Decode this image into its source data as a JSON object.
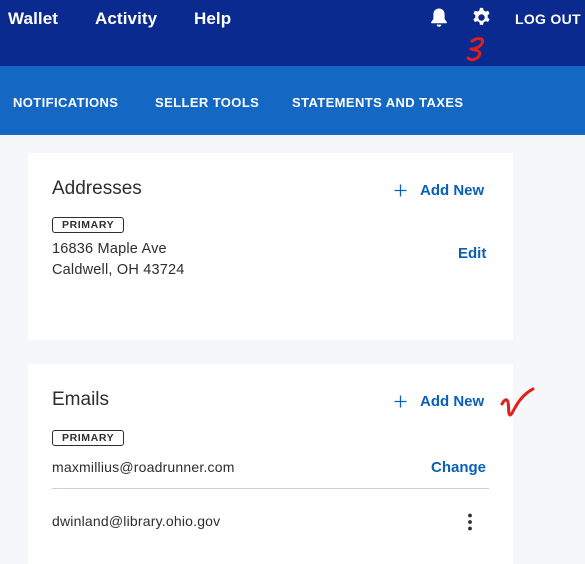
{
  "topnav": {
    "items": [
      {
        "label": "Wallet"
      },
      {
        "label": "Activity"
      },
      {
        "label": "Help"
      }
    ],
    "logout_label": "LOG OUT",
    "icons": [
      "bell-icon",
      "gear-icon"
    ]
  },
  "subnav": {
    "items": [
      {
        "label": "NOTIFICATIONS"
      },
      {
        "label": "SELLER TOOLS"
      },
      {
        "label": "STATEMENTS AND TAXES"
      }
    ]
  },
  "addresses": {
    "title": "Addresses",
    "add_new_label": "Add New",
    "badge": "PRIMARY",
    "line1": "16836 Maple Ave",
    "line2": "Caldwell, OH 43724",
    "edit_label": "Edit"
  },
  "emails": {
    "title": "Emails",
    "add_new_label": "Add New",
    "badge": "PRIMARY",
    "primary_email": "maxmillius@roadrunner.com",
    "change_label": "Change",
    "secondary_email": "dwinland@library.ohio.gov"
  },
  "colors": {
    "topbar": "#0b2a8f",
    "subbar": "#1468c4",
    "link": "#0a5fb8",
    "annotation": "#e0201b",
    "page_bg": "#f5f7fa"
  }
}
